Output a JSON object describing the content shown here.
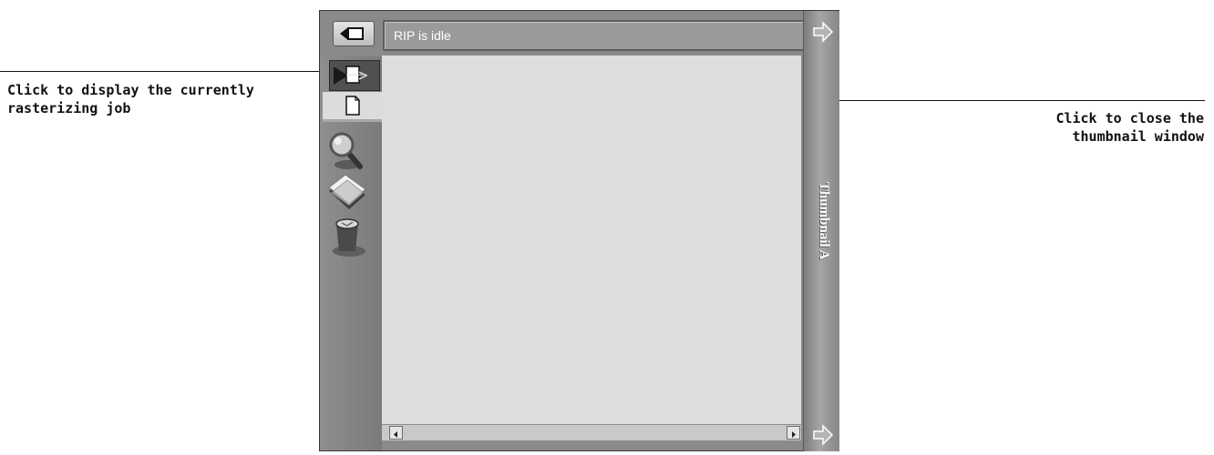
{
  "window": {
    "status_text": "RIP is idle",
    "panel_title": "Thumbnail A",
    "icons": {
      "back": "back-arrow-icon",
      "active_job": "current-job-arrow-icon",
      "job": "document-icon",
      "preview": "magnifier-icon",
      "sheets": "stacked-sheets-icon",
      "trash": "trash-icon",
      "panel_arrows": "right-arrow-icon"
    }
  },
  "callouts": {
    "left": "Click to display the currently rasterizing job",
    "right": "Click to close the thumbnail window"
  }
}
